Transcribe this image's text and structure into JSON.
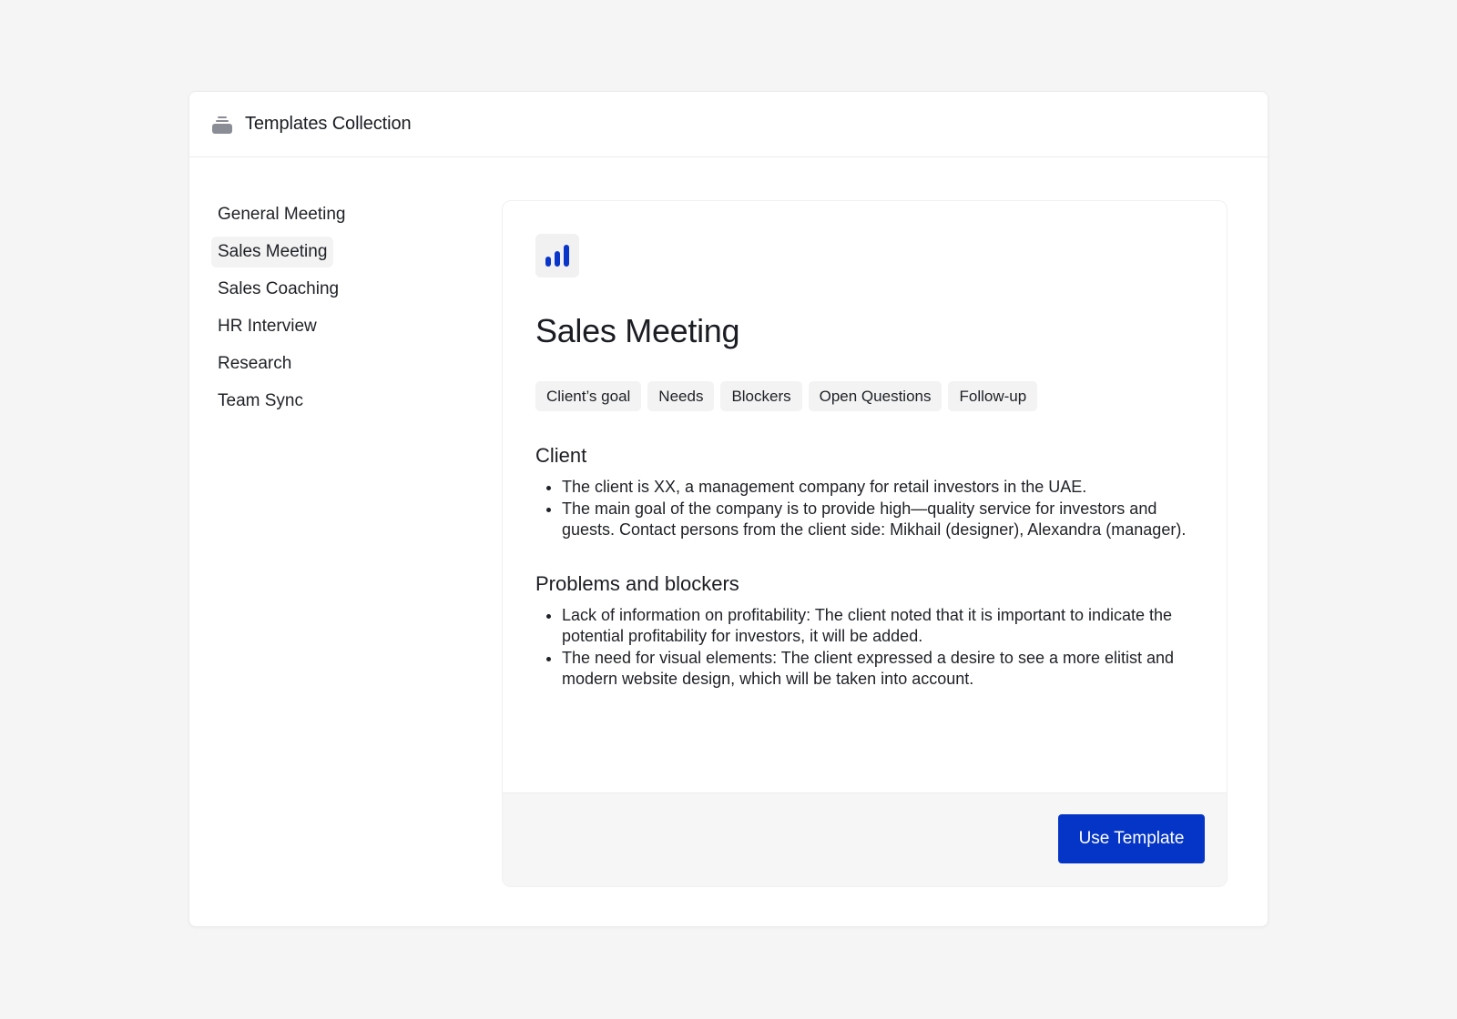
{
  "header": {
    "icon": "templates-stack-icon",
    "title": "Templates Collection"
  },
  "sidebar": {
    "selected_index": 1,
    "items": [
      {
        "label": "General Meeting"
      },
      {
        "label": "Sales Meeting"
      },
      {
        "label": "Sales Coaching"
      },
      {
        "label": "HR Interview"
      },
      {
        "label": "Research"
      },
      {
        "label": "Team Sync"
      }
    ]
  },
  "template": {
    "icon": "bar-chart-icon",
    "accent_color": "#0535c6",
    "title": "Sales Meeting",
    "tags": [
      "Client’s goal",
      "Needs",
      "Blockers",
      "Open Questions",
      "Follow-up"
    ],
    "sections": [
      {
        "title": "Client",
        "bullets": [
          "The client is XX, a management company for retail investors in the UAE.",
          "The main goal of the company is to provide high—quality service for investors and guests. Contact persons from the client side: Mikhail (designer), Alexandra (manager)."
        ]
      },
      {
        "title": "Problems and blockers",
        "bullets": [
          "Lack of information on profitability: The client noted that it is important to indicate the potential profitability for investors, it will be added.",
          "The need for visual elements: The client expressed a desire to see a more elitist and modern website design, which will be taken into account."
        ]
      }
    ]
  },
  "footer": {
    "use_button_label": "Use Template"
  }
}
